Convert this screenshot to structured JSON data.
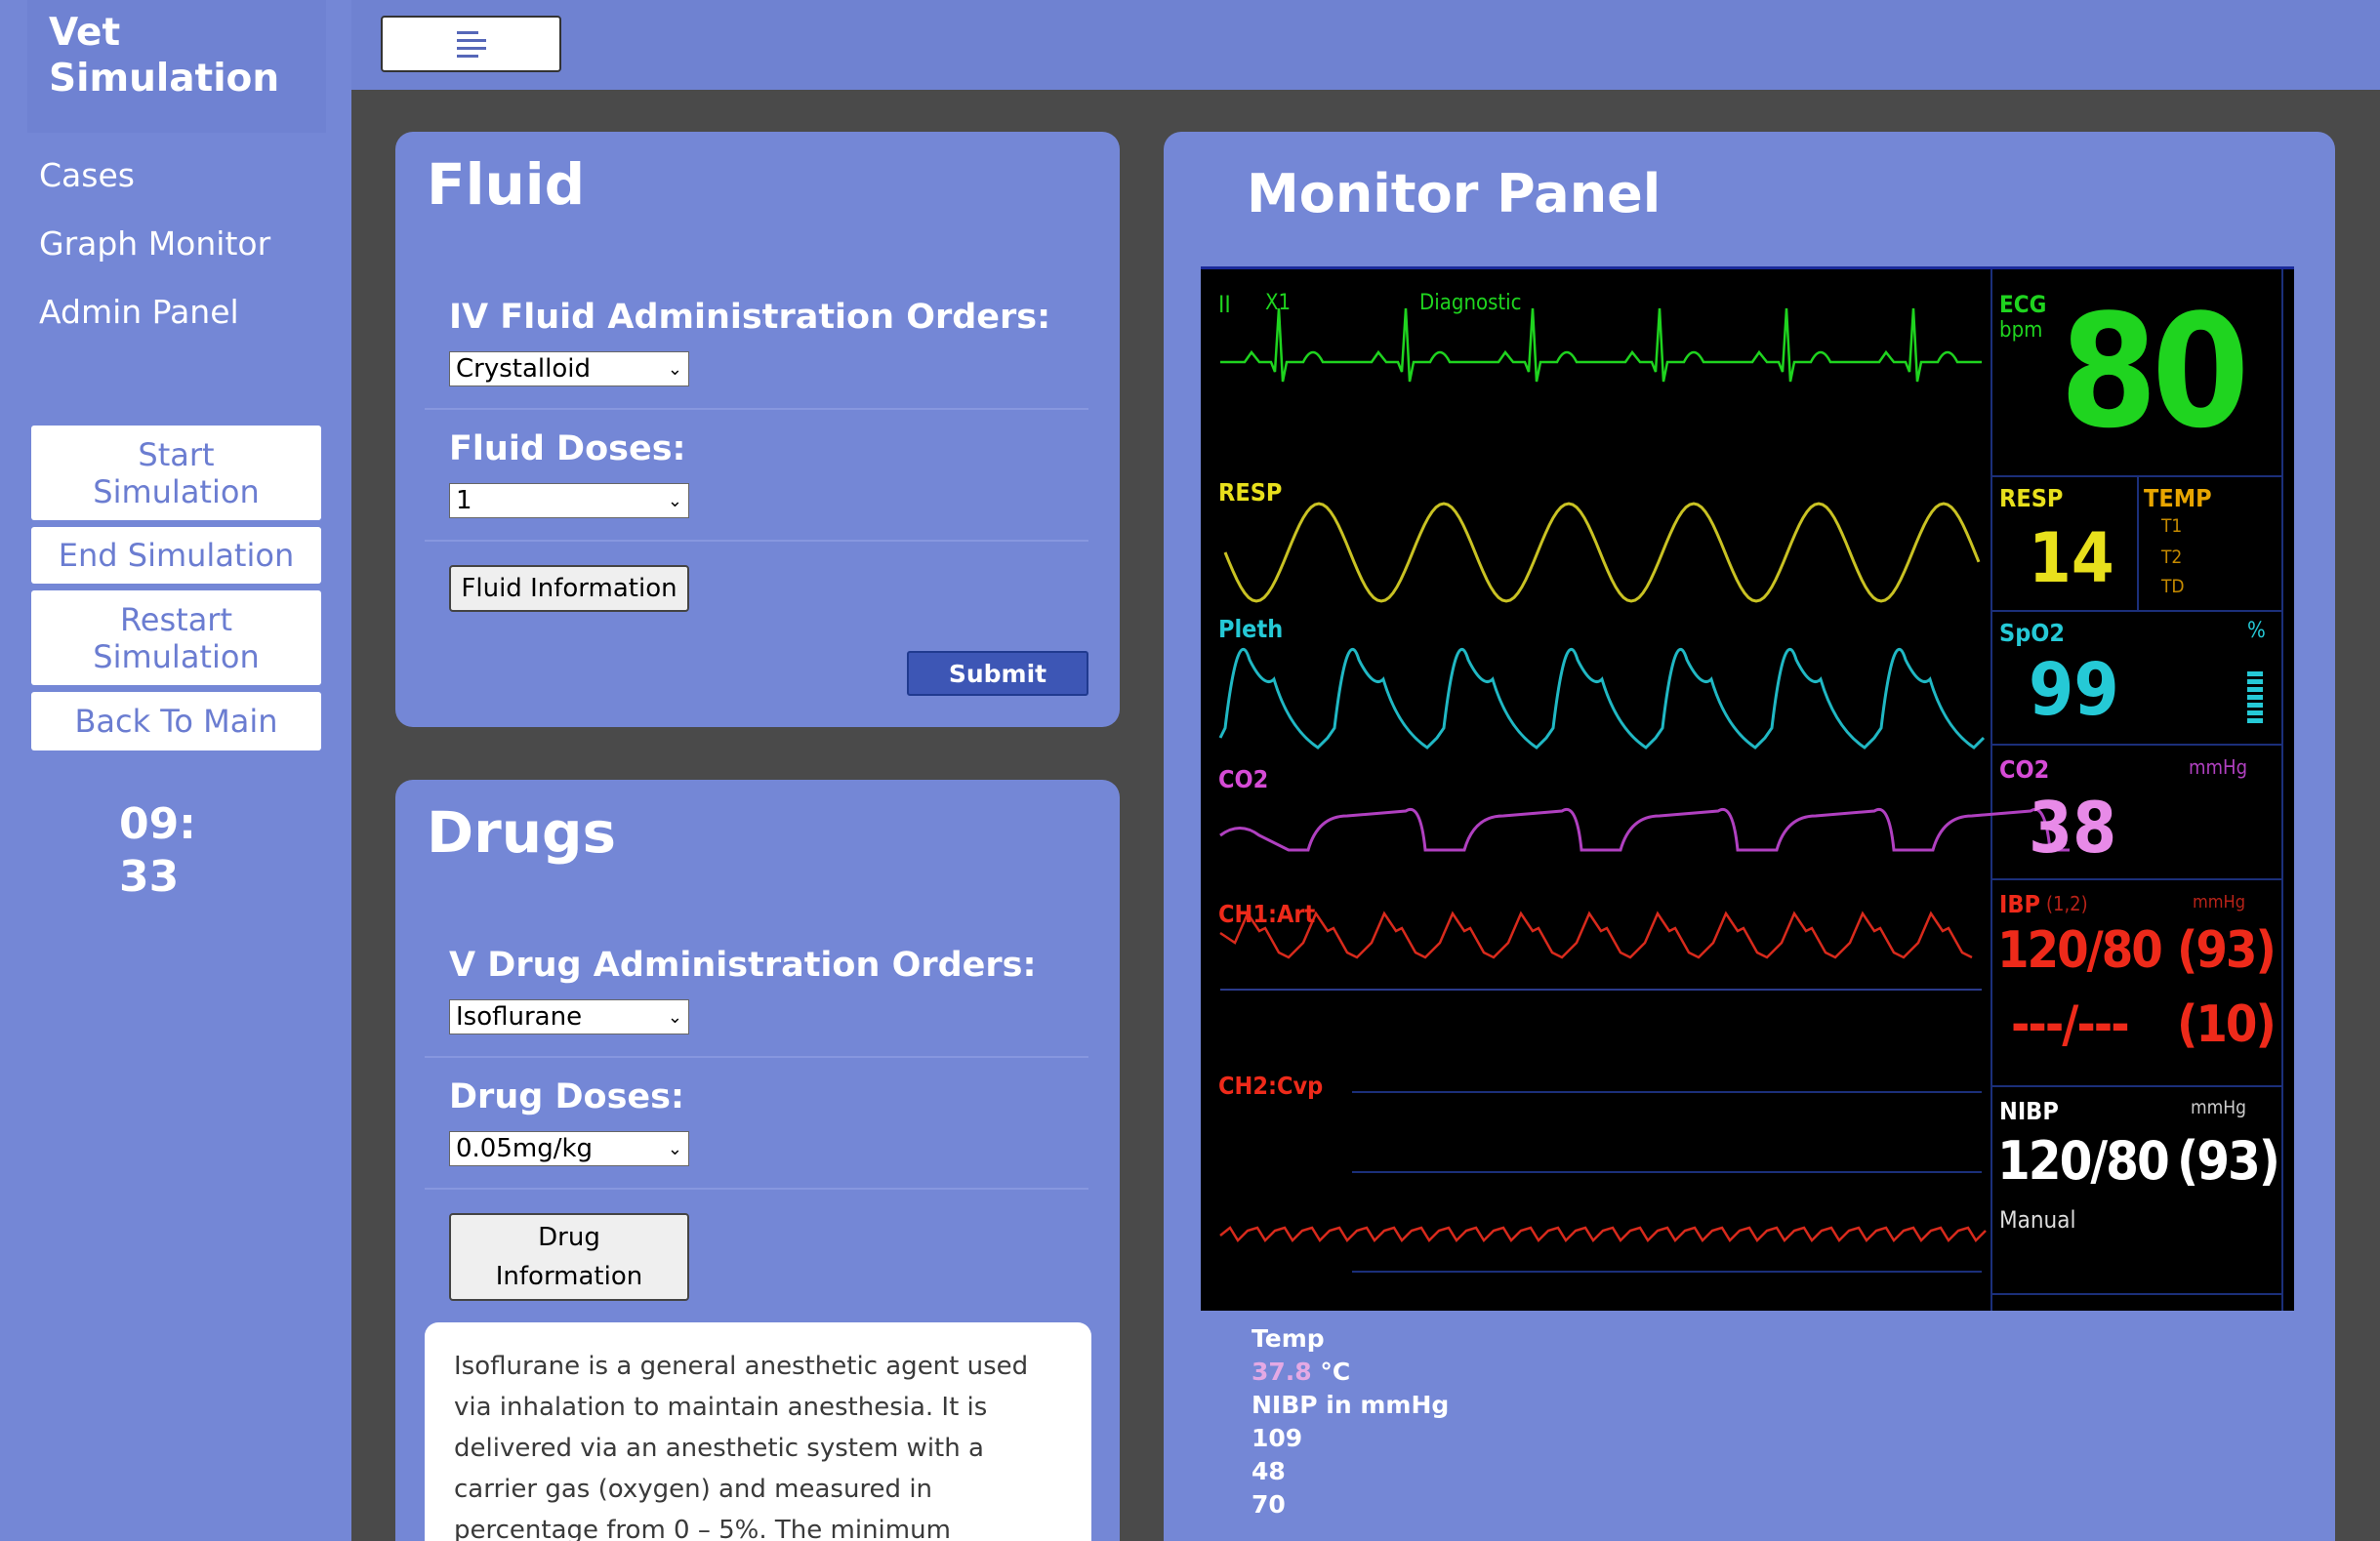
{
  "brand": {
    "line1": "Vet",
    "line2": "Simulation"
  },
  "nav": {
    "cases": "Cases",
    "graph_monitor": "Graph Monitor",
    "admin_panel": "Admin Panel"
  },
  "sim_buttons": {
    "start_l1": "Start",
    "start_l2": "Simulation",
    "end": "End Simulation",
    "restart_l1": "Restart",
    "restart_l2": "Simulation",
    "back": "Back To Main"
  },
  "timer": {
    "line1": "09:",
    "line2": "33"
  },
  "fluid": {
    "title": "Fluid",
    "orders_label": "IV Fluid Administration Orders:",
    "orders_value": "Crystalloid",
    "doses_label": "Fluid Doses:",
    "doses_value": "1",
    "info_button": "Fluid Information",
    "submit_button": "Submit"
  },
  "drugs": {
    "title": "Drugs",
    "orders_label": "V Drug Administration Orders:",
    "orders_value": "Isoflurane",
    "doses_label": "Drug Doses:",
    "doses_value": "0.05mg/kg",
    "info_button_l1": "Drug",
    "info_button_l2": "Information",
    "info_text": "Isoflurane is a general anesthetic agent used via inhalation to maintain anesthesia. It is delivered via an anesthetic system with a carrier gas (oxygen) and measured in percentage from 0 – 5%. The minimum"
  },
  "monitor": {
    "title": "Monitor Panel",
    "ecg_lead": "II",
    "ecg_gain": "X1",
    "ecg_mode": "Diagnostic",
    "ecg_label": "ECG",
    "ecg_unit": "bpm",
    "ecg_value": "80",
    "resp_wave_label": "RESP",
    "resp_label": "RESP",
    "resp_value": "14",
    "temp_label": "TEMP",
    "temp_t1": "T1",
    "temp_t2": "T2",
    "temp_td": "TD",
    "pleth_label": "Pleth",
    "spo2_label": "SpO2",
    "spo2_unit": "%",
    "spo2_value": "99",
    "co2_wave_label": "CO2",
    "co2_label": "CO2",
    "co2_unit": "mmHg",
    "co2_value": "38",
    "ch1_label": "CH1:Art",
    "ibp_label": "IBP",
    "ibp_channels": "(1,2)",
    "ibp_unit": "mmHg",
    "ibp_value": "120/80",
    "ibp_mean": "(93)",
    "ibp2_value": "---/---",
    "ibp2_mean": "(10)",
    "ch2_label": "CH2:Cvp",
    "nibp_label": "NIBP",
    "nibp_unit": "mmHg",
    "nibp_value": "120/80",
    "nibp_mean": "(93)",
    "nibp_mode": "Manual",
    "colors": {
      "ecg": "#1fd41f",
      "resp": "#e8e01c",
      "pleth": "#25c9d6",
      "co2": "#d64bd6",
      "ibp": "#ee2a1a",
      "nibp": "#ffffff"
    }
  },
  "readouts": {
    "temp_label": "Temp",
    "temp_value": "37.8",
    "temp_unit": "°C",
    "nibp_label": "NIBP in mmHg",
    "v1": "109",
    "v2": "48",
    "v3": "70"
  }
}
